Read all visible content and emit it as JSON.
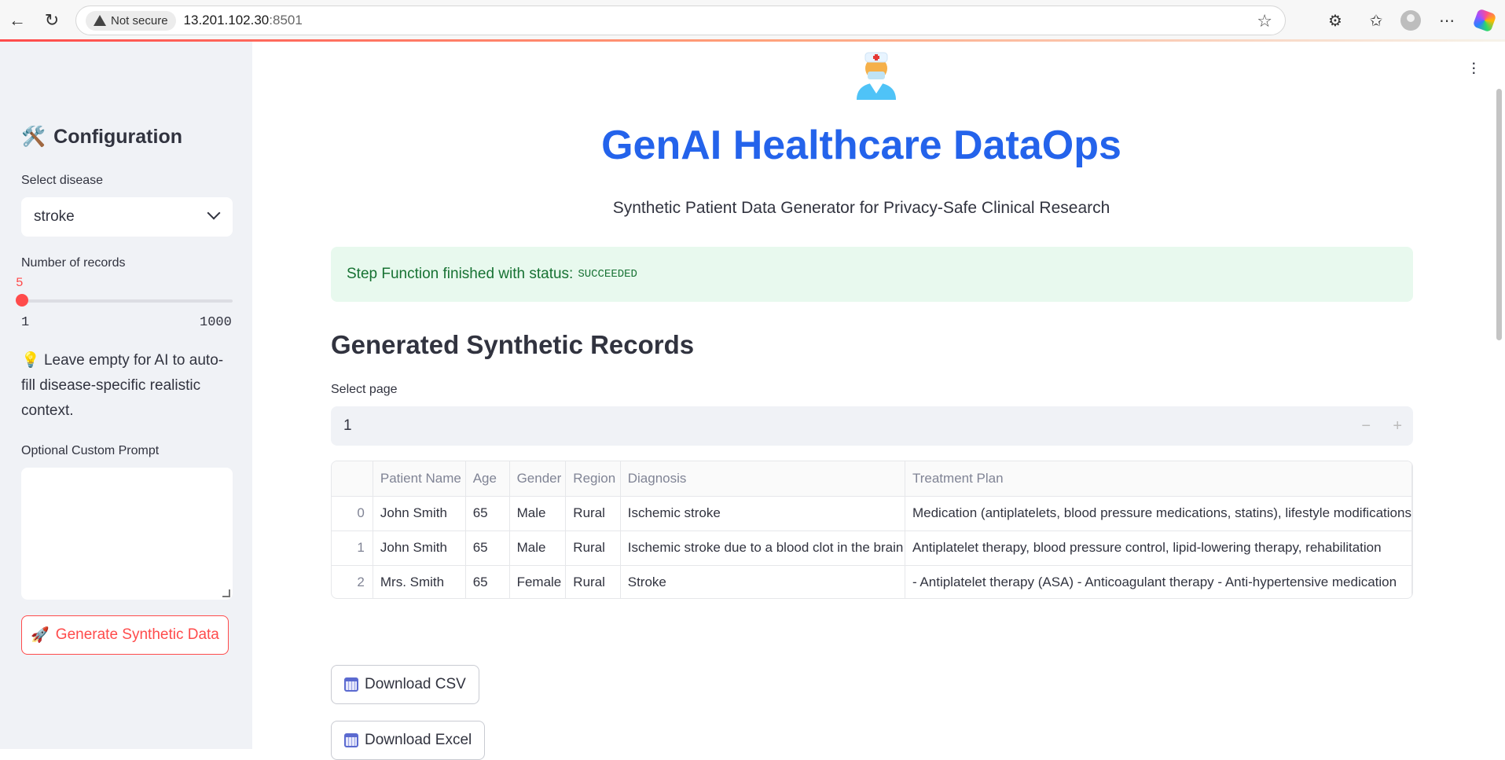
{
  "browser": {
    "security_label": "Not secure",
    "url_host": "13.201.102.30",
    "url_port": ":8501"
  },
  "sidebar": {
    "heading_emoji": "🛠️",
    "heading": "Configuration",
    "disease_label": "Select disease",
    "disease_value": "stroke",
    "records_label": "Number of records",
    "records_value": "5",
    "records_fraction": 0.004,
    "records_min": "1",
    "records_max": "1000",
    "hint_emoji": "💡",
    "hint_text": "Leave empty for AI to auto-fill disease-specific realistic context.",
    "prompt_label": "Optional Custom Prompt",
    "prompt_value": "",
    "generate_emoji": "🚀",
    "generate_label": "Generate Synthetic Data"
  },
  "main": {
    "title": "GenAI Healthcare DataOps",
    "subtitle": "Synthetic Patient Data Generator for Privacy-Safe Clinical Research",
    "alert_text": "Step Function finished with status:",
    "alert_status": "SUCCEEDED",
    "section_title": "Generated Synthetic Records",
    "page_label": "Select page",
    "page_value": "1",
    "step_minus": "−",
    "step_plus": "+",
    "download_csv": "Download CSV",
    "download_excel": "Download Excel"
  },
  "table": {
    "columns": [
      "",
      "Patient Name",
      "Age",
      "Gender",
      "Region",
      "Diagnosis",
      "Treatment Plan"
    ],
    "rows": [
      [
        "0",
        "John Smith",
        "65",
        "Male",
        "Rural",
        "Ischemic stroke",
        "Medication (antiplatelets, blood pressure medications, statins), lifestyle modifications"
      ],
      [
        "1",
        "John Smith",
        "65",
        "Male",
        "Rural",
        "Ischemic stroke due to a blood clot in the brain",
        "Antiplatelet therapy, blood pressure control, lipid-lowering therapy, rehabilitation"
      ],
      [
        "2",
        "Mrs. Smith",
        "65",
        "Female",
        "Rural",
        "Stroke",
        "- Antiplatelet therapy (ASA) - Anticoagulant therapy - Anti-hypertensive medication"
      ]
    ]
  }
}
